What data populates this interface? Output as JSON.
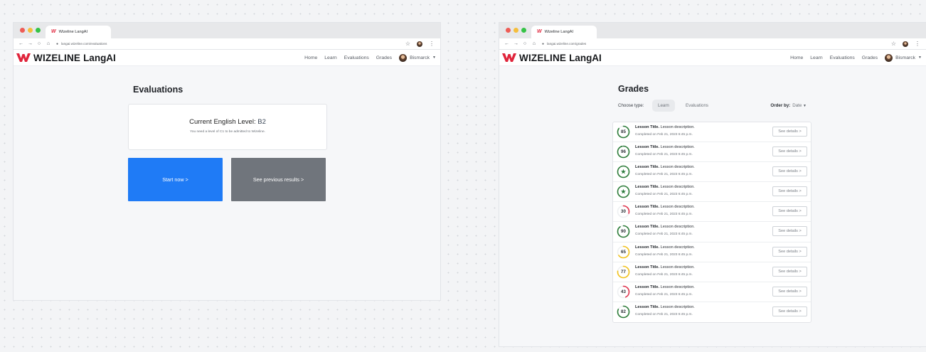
{
  "left": {
    "tab_title": "Wizeline LangAI",
    "url": "langai.wizeline.com/evaluations",
    "brand": {
      "name": "WIZELINE",
      "sub": "LangAI"
    },
    "nav": [
      "Home",
      "Learn",
      "Evaluations",
      "Grades"
    ],
    "user": "Bismarck",
    "page_title": "Evaluations",
    "level_label": "Current English Level:",
    "level_value": "B2",
    "level_note": "You need a level of C1 to be admitted to Wizeline.",
    "start_button": "Start now  >",
    "previous_button": "See previous results  >"
  },
  "right": {
    "tab_title": "Wizeline LangAI",
    "url": "langai.wizeline.com/grades",
    "brand": {
      "name": "WIZELINE",
      "sub": "LangAI"
    },
    "nav": [
      "Home",
      "Learn",
      "Evaluations",
      "Grades"
    ],
    "user": "Bismarck",
    "page_title": "Grades",
    "choose_label": "Choose type:",
    "types": [
      "Learn",
      "Evaluations"
    ],
    "active_type": "Learn",
    "order_label": "Order by:",
    "order_value": "Date",
    "details_label": "See details  >",
    "grades": [
      {
        "score": "85",
        "title": "Lesson Title.",
        "desc": "Lesson description.",
        "date": "Completed on Feb 21, 2023 6:45 p.m.",
        "color": "#2e7d3a",
        "fraction": 0.85
      },
      {
        "score": "96",
        "title": "Lesson Title.",
        "desc": "Lesson description.",
        "date": "Completed on Feb 21, 2023 6:45 p.m.",
        "color": "#2e7d3a",
        "fraction": 0.96
      },
      {
        "score": "★",
        "title": "Lesson Title.",
        "desc": "Lesson description.",
        "date": "Completed on Feb 21, 2023 6:45 p.m.",
        "color": "#2e7d3a",
        "fraction": 1.0
      },
      {
        "score": "★",
        "title": "Lesson Title.",
        "desc": "Lesson description.",
        "date": "Completed on Feb 21, 2023 6:45 p.m.",
        "color": "#2e7d3a",
        "fraction": 1.0
      },
      {
        "score": "30",
        "title": "Lesson Title.",
        "desc": "Lesson description.",
        "date": "Completed on Feb 21, 2023 6:45 p.m.",
        "color": "#e0314b",
        "fraction": 0.3
      },
      {
        "score": "90",
        "title": "Lesson Title.",
        "desc": "Lesson description.",
        "date": "Completed on Feb 21, 2023 6:45 p.m.",
        "color": "#2e7d3a",
        "fraction": 0.9
      },
      {
        "score": "65",
        "title": "Lesson Title.",
        "desc": "Lesson description.",
        "date": "Completed on Feb 21, 2023 6:45 p.m.",
        "color": "#f2c21b",
        "fraction": 0.65
      },
      {
        "score": "77",
        "title": "Lesson Title.",
        "desc": "Lesson description.",
        "date": "Completed on Feb 21, 2023 6:45 p.m.",
        "color": "#f2c21b",
        "fraction": 0.77
      },
      {
        "score": "43",
        "title": "Lesson Title.",
        "desc": "Lesson description.",
        "date": "Completed on Feb 21, 2023 6:45 p.m.",
        "color": "#e0314b",
        "fraction": 0.43
      },
      {
        "score": "82",
        "title": "Lesson Title.",
        "desc": "Lesson description.",
        "date": "Completed on Feb 21, 2023 6:45 p.m.",
        "color": "#2e7d3a",
        "fraction": 0.82
      }
    ]
  },
  "colors": {
    "primary": "#1f7bf6",
    "secondary": "#70757c",
    "brand_red": "#e0243b"
  }
}
